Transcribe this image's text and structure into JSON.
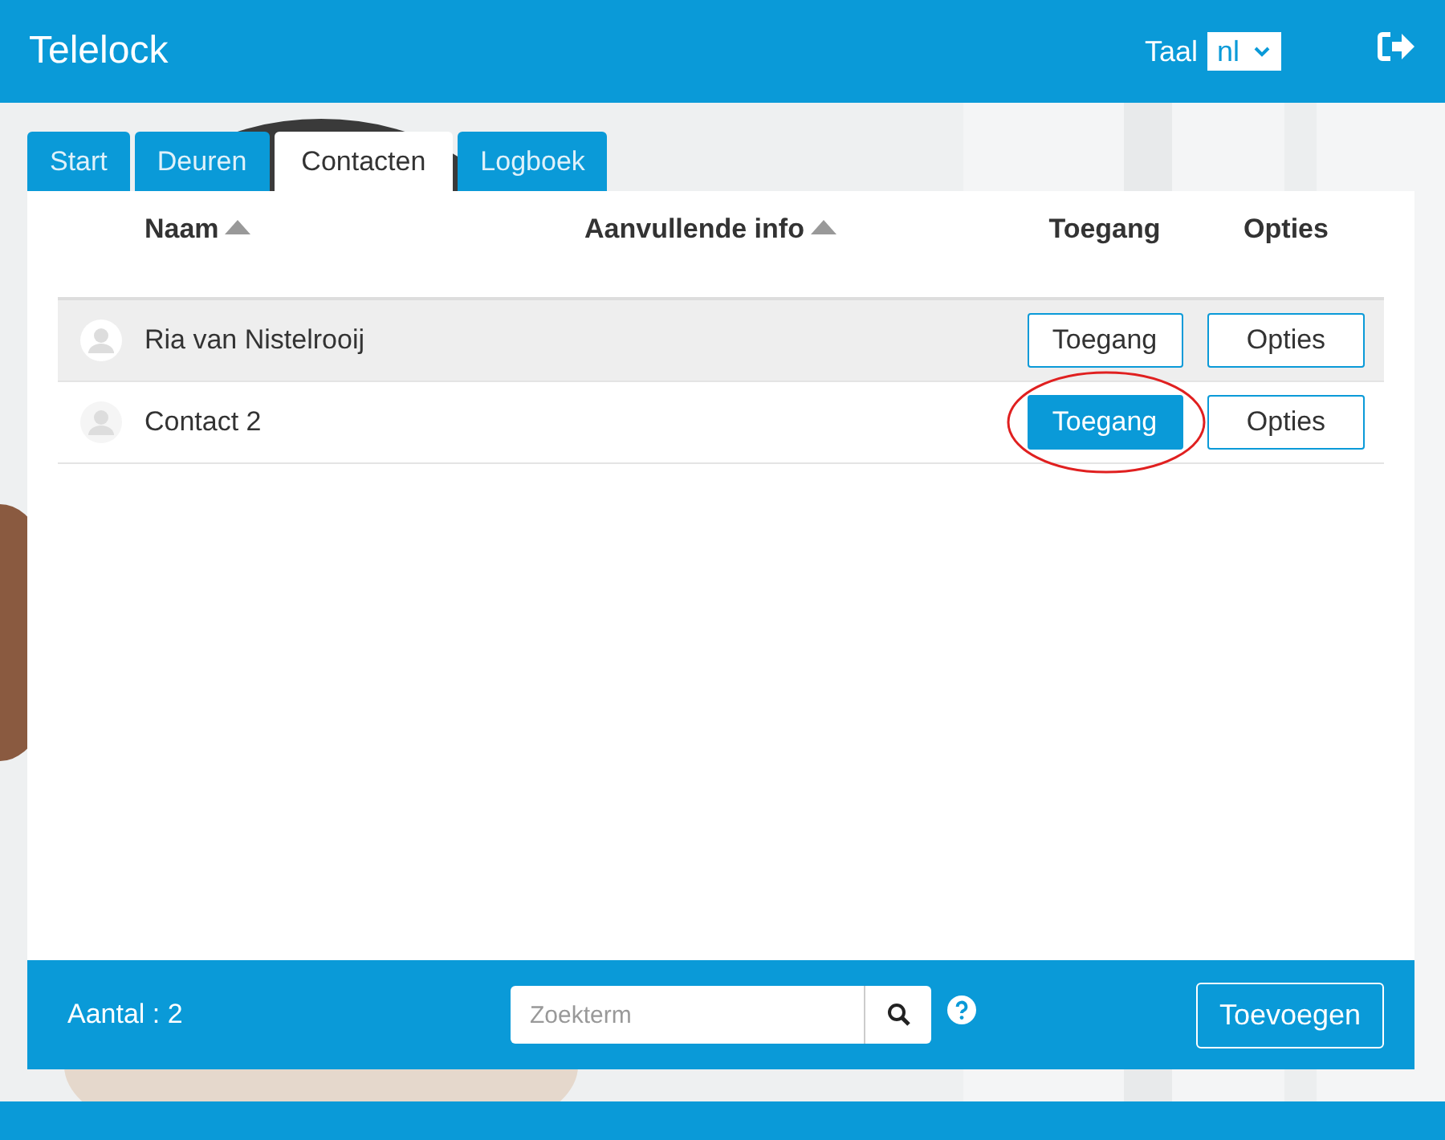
{
  "header": {
    "title": "Telelock",
    "language_label": "Taal",
    "language_value": "nl"
  },
  "tabs": [
    {
      "label": "Start",
      "selected": false
    },
    {
      "label": "Deuren",
      "selected": false
    },
    {
      "label": "Contacten",
      "selected": true
    },
    {
      "label": "Logboek",
      "selected": false
    }
  ],
  "table": {
    "columns": [
      {
        "label": "Naam",
        "sortable": true
      },
      {
        "label": "Aanvullende info",
        "sortable": true
      },
      {
        "label": "Toegang",
        "sortable": false
      },
      {
        "label": "Opties",
        "sortable": false
      }
    ],
    "rows": [
      {
        "name": "Ria van Nistelrooij",
        "access": "Toegang",
        "access_on": false,
        "circled": false,
        "hovered": true,
        "options": "Opties"
      },
      {
        "name": "Contact 2",
        "access": "Toegang",
        "access_on": true,
        "circled": true,
        "hovered": false,
        "options": "Opties"
      }
    ]
  },
  "footer": {
    "count": "Aantal : 2",
    "search": {
      "placeholder": "Zoekterm"
    },
    "add_button": "Toevoegen"
  }
}
